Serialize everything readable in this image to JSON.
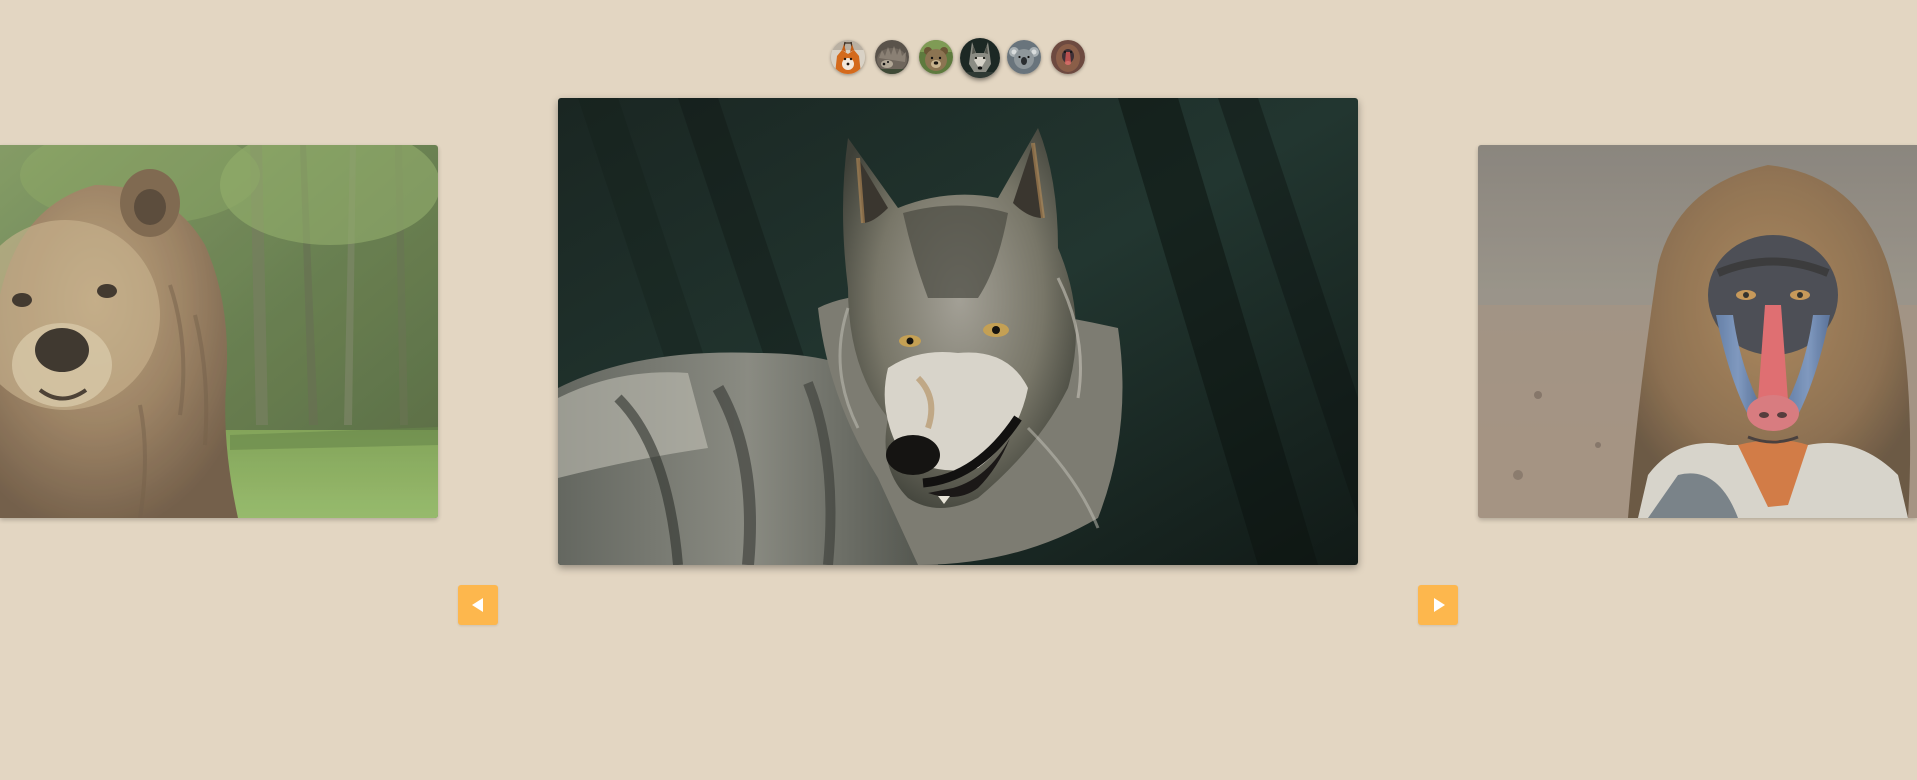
{
  "colors": {
    "page_background": "#e3d6c2",
    "arrow_accent": "#fdb74d",
    "arrow_glyph": "#ffffff"
  },
  "carousel": {
    "active_index": 3,
    "thumbnails": [
      {
        "subject": "fox",
        "icon": "fox-thumbnail-icon"
      },
      {
        "subject": "hedgehog",
        "icon": "hedgehog-thumbnail-icon"
      },
      {
        "subject": "bear",
        "icon": "bear-thumbnail-icon"
      },
      {
        "subject": "wolf",
        "icon": "wolf-thumbnail-icon"
      },
      {
        "subject": "koala",
        "icon": "koala-thumbnail-icon"
      },
      {
        "subject": "mandrill",
        "icon": "mandrill-thumbnail-icon"
      }
    ],
    "slides": {
      "previous": {
        "subject": "bear"
      },
      "current": {
        "subject": "wolf"
      },
      "next": {
        "subject": "mandrill"
      }
    },
    "controls": {
      "prev_icon": "triangle-left-icon",
      "next_icon": "triangle-right-icon"
    }
  }
}
